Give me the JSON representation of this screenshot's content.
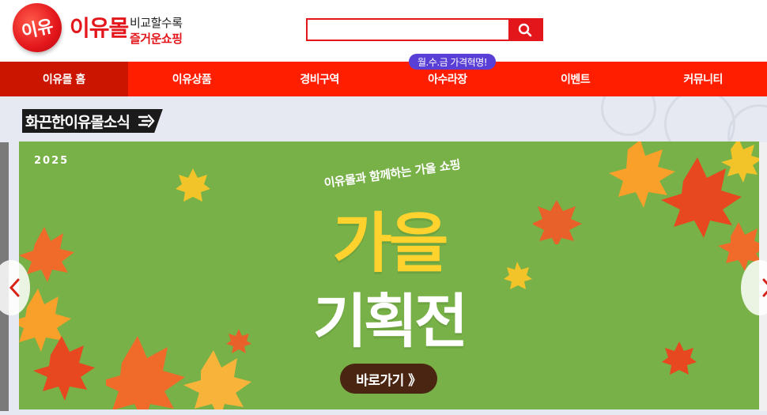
{
  "header": {
    "logo_badge": "이유",
    "logo_name": "이유몰",
    "logo_tagline_1": "비교할수록",
    "logo_tagline_2": "즐거운쇼핑",
    "search": {
      "value": "",
      "placeholder": ""
    }
  },
  "promo_badge": "월.수.금 가격혁명!",
  "nav": {
    "items": [
      {
        "label": "이유몰 홈"
      },
      {
        "label": "이유상품"
      },
      {
        "label": "경비구역"
      },
      {
        "label": "아수라장"
      },
      {
        "label": "이벤트"
      },
      {
        "label": "커뮤니티"
      }
    ],
    "active_index": 0
  },
  "section": {
    "title": "화끈한이유몰소식"
  },
  "banner": {
    "year": "2025",
    "subtitle": "이유몰과 함께하는 가을 쇼핑",
    "title_line1": "가을",
    "title_line2": "기획전",
    "cta": "바로가기 》"
  },
  "colors": {
    "brand_red": "#e3161b",
    "nav_red": "#ff1e00",
    "nav_active": "#cc1500",
    "banner_green": "#78b147",
    "title_yellow": "#ffd22e",
    "cta_brown": "#4a2512",
    "badge_purple": "#5a3fd6"
  },
  "icons": {
    "search": "search-icon",
    "prev": "chevron-left-icon",
    "next": "chevron-right-icon"
  }
}
